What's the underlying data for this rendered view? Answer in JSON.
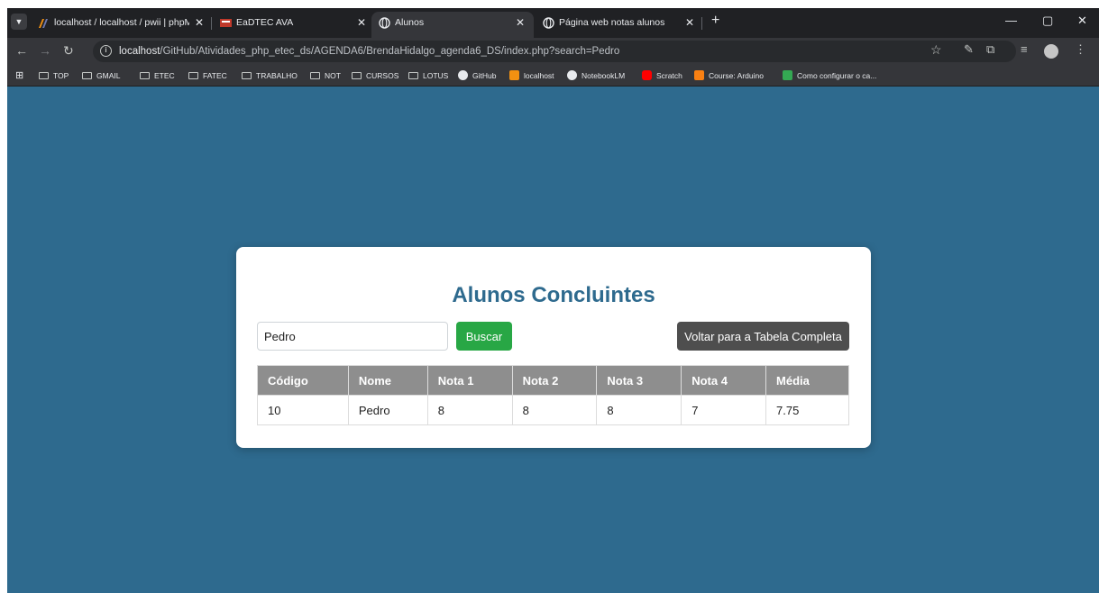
{
  "browser": {
    "tabs": [
      {
        "title": "localhost / localhost / pwii | phpM",
        "favicon": "phpmyadmin-icon"
      },
      {
        "title": "EaDTEC AVA",
        "favicon": "eadtec-icon"
      },
      {
        "title": "Alunos",
        "favicon": "globe-icon",
        "active": true
      },
      {
        "title": "Página web notas alunos",
        "favicon": "globe-icon"
      }
    ],
    "url_host": "localhost",
    "url_path": "/GitHub/Atividades_php_etec_ds/AGENDA6/BrendaHidalgo_agenda6_DS/index.php?search=Pedro",
    "bookmarks": [
      {
        "label": "TOP",
        "icon": "folder-icon"
      },
      {
        "label": "GMAIL",
        "icon": "folder-icon"
      },
      {
        "label": "ETEC",
        "icon": "folder-icon"
      },
      {
        "label": "FATEC",
        "icon": "folder-icon"
      },
      {
        "label": "TRABALHO",
        "icon": "folder-icon"
      },
      {
        "label": "NOT",
        "icon": "folder-icon"
      },
      {
        "label": "CURSOS",
        "icon": "folder-icon"
      },
      {
        "label": "LOTUS",
        "icon": "folder-icon"
      },
      {
        "label": "GitHub",
        "icon": "github-icon"
      },
      {
        "label": "localhost",
        "icon": "phpmyadmin-icon"
      },
      {
        "label": "NotebookLM",
        "icon": "notebooklm-icon"
      },
      {
        "label": "Scratch",
        "icon": "youtube-icon"
      },
      {
        "label": "Course: Arduino",
        "icon": "moodle-icon"
      },
      {
        "label": "Como configurar o ca...",
        "icon": "drive-icon"
      }
    ]
  },
  "page": {
    "title": "Alunos Concluintes",
    "search_value": "Pedro",
    "search_button": "Buscar",
    "back_button": "Voltar para a Tabela Completa",
    "columns": [
      "Código",
      "Nome",
      "Nota 1",
      "Nota 2",
      "Nota 3",
      "Nota 4",
      "Média"
    ],
    "rows": [
      [
        "10",
        "Pedro",
        "8",
        "8",
        "8",
        "7",
        "7.75"
      ]
    ]
  },
  "colors": {
    "background": "#2e6a8e",
    "title": "#2e6a8e",
    "search_button": "#28a745",
    "back_button": "#4e4e4e",
    "table_header": "#8e8e8e"
  }
}
